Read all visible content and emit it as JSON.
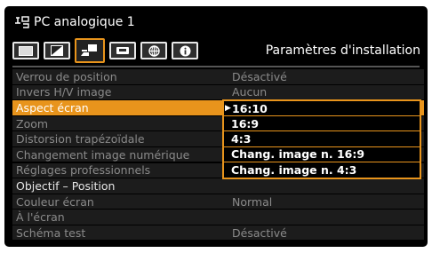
{
  "header": {
    "source_icon": "pc-input-icon",
    "title": "PC analogique 1"
  },
  "tabs": [
    {
      "icon": "image-adjust-icon",
      "active": false
    },
    {
      "icon": "picture-quality-icon",
      "active": false
    },
    {
      "icon": "installation-icon",
      "active": true
    },
    {
      "icon": "network-icon",
      "active": false
    },
    {
      "icon": "globe-icon",
      "active": false
    },
    {
      "icon": "info-icon",
      "active": false
    }
  ],
  "tab_title": "Paramètres d'installation",
  "menu": {
    "rows": [
      {
        "label": "Verrou de position",
        "value": "Désactivé"
      },
      {
        "label": "Invers H/V image",
        "value": "Aucun"
      },
      {
        "label": "Aspect écran",
        "value": ""
      },
      {
        "label": "Zoom",
        "value": ""
      },
      {
        "label": "Distorsion trapézoïdale",
        "value": ""
      },
      {
        "label": "Changement image numérique",
        "value": ""
      },
      {
        "label": "Réglages professionnels",
        "value": ""
      },
      {
        "label": "Objectif – Position",
        "value": ""
      },
      {
        "label": "Couleur écran",
        "value": "Normal"
      },
      {
        "label": "À l'écran",
        "value": ""
      },
      {
        "label": "Schéma test",
        "value": "Désactivé"
      }
    ]
  },
  "dropdown": {
    "options": [
      "16:10",
      "16:9",
      "4:3",
      "Chang. image n. 16:9",
      "Chang. image n. 4:3"
    ],
    "selected_index": 0
  },
  "colors": {
    "accent": "#e8941c",
    "background": "#000000",
    "row": "#1c1c1c"
  }
}
